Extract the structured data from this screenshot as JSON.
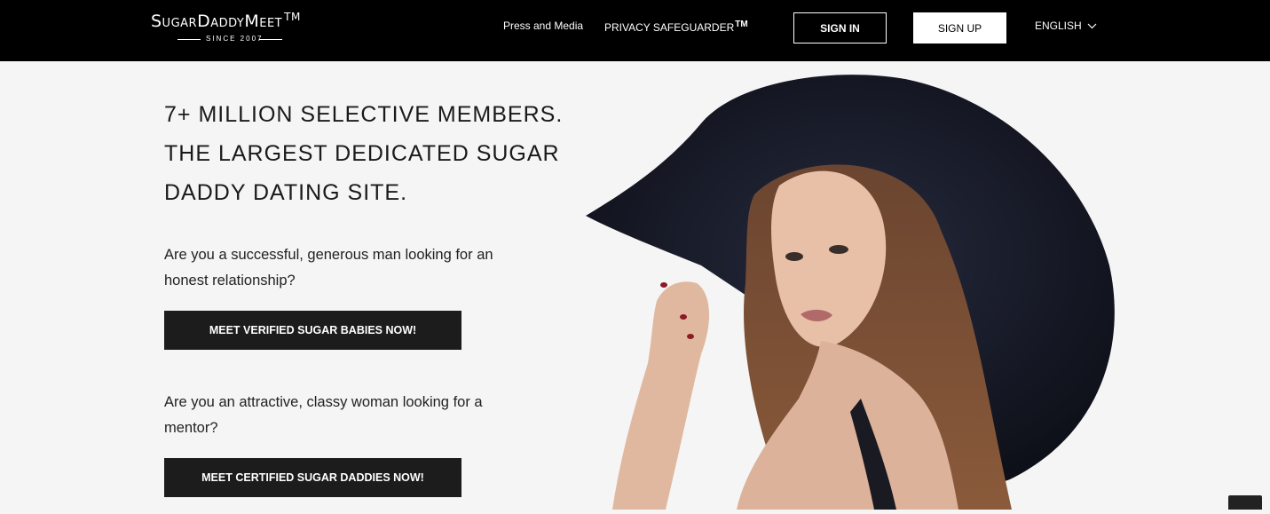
{
  "header": {
    "logo_text": "SugarDaddyMeet",
    "logo_tm": "TM",
    "logo_since": "SINCE 2007",
    "nav": {
      "press": "Press and Media",
      "privacy": "PRIVACY SAFEGUARDER",
      "privacy_tm": "TM"
    },
    "sign_in": "SIGN IN",
    "sign_up": "SIGN UP",
    "language": "ENGLISH",
    "language_icon": "chevron-down-icon"
  },
  "hero": {
    "headline": [
      "7+ MILLION SELECTIVE MEMBERS.",
      "THE LARGEST DEDICATED SUGAR",
      "DADDY DATING SITE."
    ],
    "question_men": "Are you a successful, generous man looking for an honest relationship?",
    "cta_men": "MEET VERIFIED SUGAR BABIES NOW!",
    "question_women": "Are you an attractive, classy woman looking for a mentor?",
    "cta_women": "MEET CERTIFIED SUGAR DADDIES NOW!"
  },
  "colors": {
    "header_bg": "#000000",
    "page_bg": "#f5f5f5",
    "button_dark": "#1c1c1c"
  }
}
